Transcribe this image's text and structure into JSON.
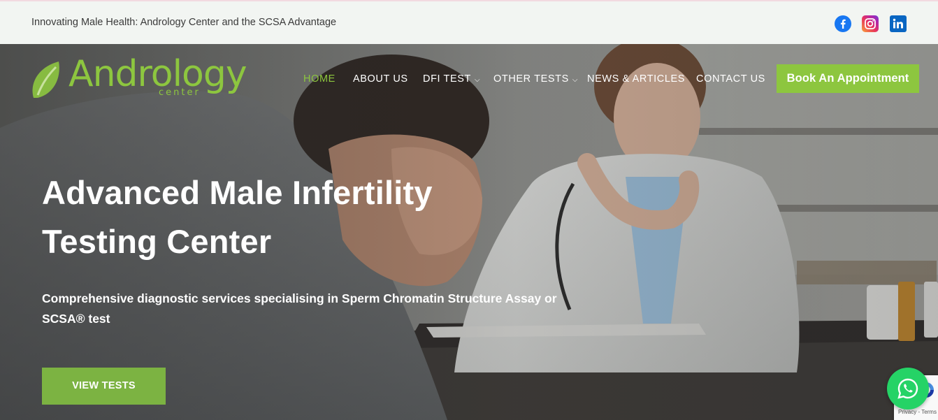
{
  "topbar": {
    "tagline": "Innovating Male Health: Andrology Center and the SCSA Advantage",
    "social": [
      {
        "name": "facebook-icon",
        "color": "#1877f2"
      },
      {
        "name": "instagram-icon",
        "color": "#e8355d"
      },
      {
        "name": "linkedin-icon",
        "color": "#0a66c2"
      }
    ]
  },
  "logo": {
    "word": "Andrology",
    "sub": "center"
  },
  "nav": {
    "items": [
      {
        "label": "HOME",
        "active": true
      },
      {
        "label": "ABOUT US"
      },
      {
        "label": "DFI TEST",
        "dropdown": true
      },
      {
        "label": "OTHER TESTS",
        "dropdown": true
      },
      {
        "label": "NEWS & ARTICLES"
      },
      {
        "label": "CONTACT US"
      }
    ],
    "cta": "Book An Appointment",
    "dropdown_glyph": "⌵"
  },
  "hero": {
    "title_line1": "Advanced Male Infertility",
    "title_line2": "Testing Center",
    "subtitle_line1": "Comprehensive diagnostic services specialising in Sperm Chromatin Structure Assay or",
    "subtitle_line2": "SCSA® test",
    "button": "VIEW TESTS"
  },
  "widgets": {
    "chat_icon": "whatsapp-icon",
    "recaptcha_text": "Privacy - Terms"
  },
  "colors": {
    "accent": "#8dc63f",
    "button": "#7cb342",
    "topbar_bg": "#f2f5f2",
    "whatsapp": "#25d366"
  }
}
